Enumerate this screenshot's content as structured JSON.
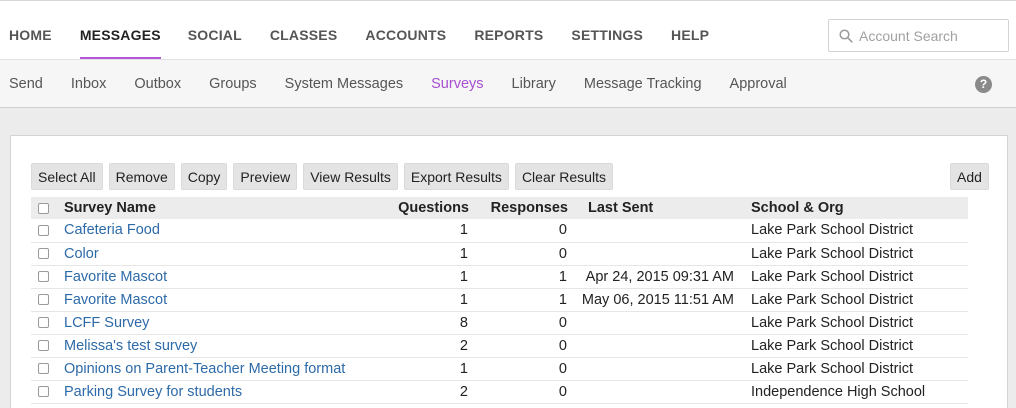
{
  "top_nav": {
    "items": [
      {
        "label": "HOME",
        "active": false
      },
      {
        "label": "MESSAGES",
        "active": true
      },
      {
        "label": "SOCIAL",
        "active": false
      },
      {
        "label": "CLASSES",
        "active": false
      },
      {
        "label": "ACCOUNTS",
        "active": false
      },
      {
        "label": "REPORTS",
        "active": false
      },
      {
        "label": "SETTINGS",
        "active": false
      },
      {
        "label": "HELP",
        "active": false
      }
    ],
    "accent_color": "#b455d6"
  },
  "search": {
    "placeholder": "Account Search",
    "icon": "search-icon"
  },
  "sub_nav": {
    "items": [
      {
        "label": "Send",
        "active": false
      },
      {
        "label": "Inbox",
        "active": false
      },
      {
        "label": "Outbox",
        "active": false
      },
      {
        "label": "Groups",
        "active": false
      },
      {
        "label": "System Messages",
        "active": false
      },
      {
        "label": "Surveys",
        "active": true
      },
      {
        "label": "Library",
        "active": false
      },
      {
        "label": "Message Tracking",
        "active": false
      },
      {
        "label": "Approval",
        "active": false
      }
    ],
    "help_icon": "question-circle-icon",
    "help_glyph": "?"
  },
  "toolbar": {
    "buttons": [
      "Select All",
      "Remove",
      "Copy",
      "Preview",
      "View Results",
      "Export Results",
      "Clear Results"
    ],
    "add_label": "Add"
  },
  "table": {
    "headers": {
      "name": "Survey Name",
      "questions": "Questions",
      "responses": "Responses",
      "last_sent": "Last Sent",
      "school_org": "School & Org"
    },
    "rows": [
      {
        "name": "Cafeteria Food",
        "questions": "1",
        "responses": "0",
        "last_sent": "",
        "school_org": "Lake Park School District"
      },
      {
        "name": "Color",
        "questions": "1",
        "responses": "0",
        "last_sent": "",
        "school_org": "Lake Park School District"
      },
      {
        "name": "Favorite Mascot",
        "questions": "1",
        "responses": "1",
        "last_sent": "Apr 24, 2015 09:31 AM",
        "school_org": "Lake Park School District"
      },
      {
        "name": "Favorite Mascot",
        "questions": "1",
        "responses": "1",
        "last_sent": "May 06, 2015 11:51 AM",
        "school_org": "Lake Park School District"
      },
      {
        "name": "LCFF Survey",
        "questions": "8",
        "responses": "0",
        "last_sent": "",
        "school_org": "Lake Park School District"
      },
      {
        "name": "Melissa's test survey",
        "questions": "2",
        "responses": "0",
        "last_sent": "",
        "school_org": "Lake Park School District"
      },
      {
        "name": "Opinions on Parent-Teacher Meeting format",
        "questions": "1",
        "responses": "0",
        "last_sent": "",
        "school_org": "Lake Park School District"
      },
      {
        "name": "Parking Survey for students",
        "questions": "2",
        "responses": "0",
        "last_sent": "",
        "school_org": "Independence High School"
      }
    ]
  }
}
